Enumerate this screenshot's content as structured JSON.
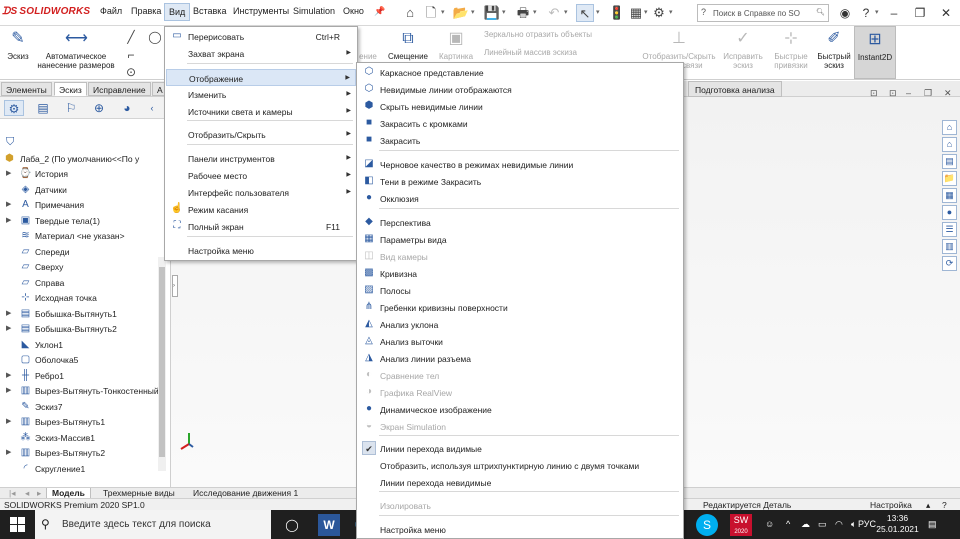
{
  "app": {
    "logo_text": "SOLIDWORKS",
    "brand_color": "#d21f1f"
  },
  "menubar": [
    "Файл",
    "Правка",
    "Вид",
    "Вставка",
    "Инструменты",
    "Simulation",
    "Окно"
  ],
  "search": {
    "placeholder": "Поиск в Справке по SO"
  },
  "cmd": {
    "sketch": "Эскиз",
    "smart_dim": "Автоматическое нанесение размеров",
    "mirror": "Зеркально отразить объекты",
    "linear_pattern": "Линейный массив эскиза",
    "offset_short": "Смещение",
    "offset_partial": "ение",
    "trim": "Картинка",
    "show_relations": "Отобразить/Скрыть взаимосвязи",
    "repair": "Исправить эскиз",
    "quick_snaps": "Быстрые привязки",
    "rapid_sketch": "Быстрый эскиз",
    "instant2d": "Instant2D"
  },
  "tabs": [
    "Элементы",
    "Эскиз",
    "Исправление",
    "А"
  ],
  "analysis_tab": "Подготовка анализа",
  "tree": {
    "root": "Лаба_2  (По умолчанию<<По у",
    "items": [
      {
        "label": "История",
        "arrow": true,
        "icon": "history-icon"
      },
      {
        "label": "Датчики",
        "arrow": false,
        "icon": "sensor-icon"
      },
      {
        "label": "Примечания",
        "arrow": true,
        "icon": "annotation-icon"
      },
      {
        "label": "Твердые тела(1)",
        "arrow": true,
        "icon": "solid-bodies-icon"
      },
      {
        "label": "Материал <не указан>",
        "arrow": false,
        "icon": "material-icon"
      },
      {
        "label": "Спереди",
        "arrow": false,
        "icon": "plane-icon"
      },
      {
        "label": "Сверху",
        "arrow": false,
        "icon": "plane-icon"
      },
      {
        "label": "Справа",
        "arrow": false,
        "icon": "plane-icon"
      },
      {
        "label": "Исходная точка",
        "arrow": false,
        "icon": "origin-icon"
      },
      {
        "label": "Бобышка-Вытянуть1",
        "arrow": true,
        "icon": "extrude-icon"
      },
      {
        "label": "Бобышка-Вытянуть2",
        "arrow": true,
        "icon": "extrude-icon"
      },
      {
        "label": "Уклон1",
        "arrow": false,
        "icon": "draft-icon"
      },
      {
        "label": "Оболочка5",
        "arrow": false,
        "icon": "shell-icon"
      },
      {
        "label": "Ребро1",
        "arrow": true,
        "icon": "rib-icon"
      },
      {
        "label": "Вырез-Вытянуть-Тонкостенный",
        "arrow": true,
        "icon": "cut-icon"
      },
      {
        "label": "Эскиз7",
        "arrow": false,
        "icon": "sketch-icon"
      },
      {
        "label": "Вырез-Вытянуть1",
        "arrow": true,
        "icon": "cut-icon"
      },
      {
        "label": "Эскиз-Массив1",
        "arrow": false,
        "icon": "sketch-pattern-icon"
      },
      {
        "label": "Вырез-Вытянуть2",
        "arrow": true,
        "icon": "cut-icon"
      },
      {
        "label": "Скругление1",
        "arrow": false,
        "icon": "fillet-icon"
      }
    ]
  },
  "view_menu": {
    "items": [
      {
        "label": "Перерисовать",
        "shortcut": "Ctrl+R",
        "icon": "redraw-icon",
        "submenu": false
      },
      {
        "label": "Захват экрана",
        "shortcut": "",
        "icon": "",
        "submenu": true
      },
      {
        "label": "Отображение",
        "shortcut": "",
        "icon": "",
        "submenu": true
      },
      {
        "label": "Изменить",
        "shortcut": "",
        "icon": "",
        "submenu": true
      },
      {
        "label": "Источники света и камеры",
        "shortcut": "",
        "icon": "",
        "submenu": true
      },
      {
        "label": "Отобразить/Скрыть",
        "shortcut": "",
        "icon": "",
        "submenu": true
      },
      {
        "label": "Панели инструментов",
        "shortcut": "",
        "icon": "",
        "submenu": true
      },
      {
        "label": "Рабочее место",
        "shortcut": "",
        "icon": "",
        "submenu": true
      },
      {
        "label": "Интерфейс пользователя",
        "shortcut": "",
        "icon": "",
        "submenu": true
      },
      {
        "label": "Режим касания",
        "shortcut": "",
        "icon": "touch-icon",
        "submenu": false
      },
      {
        "label": "Полный экран",
        "shortcut": "F11",
        "icon": "fullscreen-icon",
        "submenu": false
      },
      {
        "label": "Настройка меню",
        "shortcut": "",
        "icon": "",
        "submenu": false
      }
    ]
  },
  "display_menu": {
    "items": [
      {
        "label": "Каркасное представление",
        "icon": "wireframe-icon",
        "disabled": false
      },
      {
        "label": "Невидимые линии отображаются",
        "icon": "hidden-lines-visible-icon",
        "disabled": false
      },
      {
        "label": "Скрыть невидимые линии",
        "icon": "hidden-lines-removed-icon",
        "disabled": false
      },
      {
        "label": "Закрасить с кромками",
        "icon": "shaded-edges-icon",
        "disabled": false
      },
      {
        "label": "Закрасить",
        "icon": "shaded-icon",
        "disabled": false
      },
      {
        "label": "Черновое качество в режимах невидимые линии",
        "icon": "draft-quality-icon",
        "disabled": false
      },
      {
        "label": "Тени в режиме Закрасить",
        "icon": "shadows-icon",
        "disabled": false
      },
      {
        "label": "Окклюзия",
        "icon": "occlusion-icon",
        "disabled": false
      },
      {
        "label": "Перспектива",
        "icon": "perspective-icon",
        "disabled": false
      },
      {
        "label": "Параметры вида",
        "icon": "view-settings-icon",
        "disabled": false
      },
      {
        "label": "Вид камеры",
        "icon": "camera-icon",
        "disabled": true
      },
      {
        "label": "Кривизна",
        "icon": "curvature-icon",
        "disabled": false
      },
      {
        "label": "Полосы",
        "icon": "zebra-stripes-icon",
        "disabled": false
      },
      {
        "label": "Гребенки кривизны поверхности",
        "icon": "curvature-combs-icon",
        "disabled": false
      },
      {
        "label": "Анализ уклона",
        "icon": "draft-analysis-icon",
        "disabled": false
      },
      {
        "label": "Анализ выточки",
        "icon": "undercut-analysis-icon",
        "disabled": false
      },
      {
        "label": "Анализ линии разъема",
        "icon": "parting-line-icon",
        "disabled": false
      },
      {
        "label": "Сравнение тел",
        "icon": "compare-bodies-icon",
        "disabled": true
      },
      {
        "label": "Графика RealView",
        "icon": "realview-icon",
        "disabled": true
      },
      {
        "label": "Динамическое изображение",
        "icon": "ambient-icon",
        "disabled": false
      },
      {
        "label": "Экран Simulation",
        "icon": "simulation-icon",
        "disabled": true
      },
      {
        "label": "Линии перехода видимые",
        "icon": "check-icon",
        "disabled": false
      },
      {
        "label": "Отобразить, используя штрихпунктирную линию с двумя точками",
        "icon": "",
        "disabled": false
      },
      {
        "label": "Линии перехода невидимые",
        "icon": "",
        "disabled": false
      },
      {
        "label": "Изолировать",
        "icon": "",
        "disabled": true
      },
      {
        "label": "Настройка меню",
        "icon": "",
        "disabled": false
      }
    ]
  },
  "bottom_tabs": [
    "Модель",
    "Трехмерные виды",
    "Исследование движения 1"
  ],
  "status": {
    "left": "SOLIDWORKS Premium 2020 SP1.0",
    "editing": "Редактируется Деталь",
    "settings": "Настройка"
  },
  "taskbar": {
    "search_placeholder": "Введите здесь текст для поиска",
    "lang": "РУС",
    "time": "13:36",
    "date": "25.01.2021",
    "sw_badge": "2020"
  }
}
